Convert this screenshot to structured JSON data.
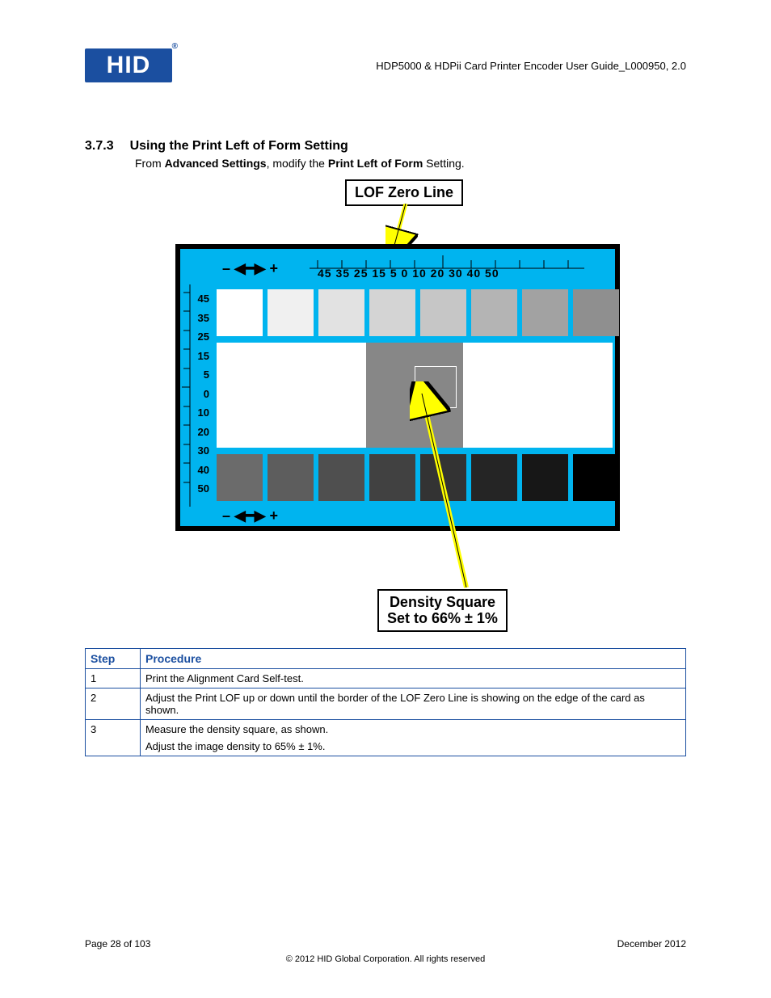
{
  "header": {
    "logo_text": "HID",
    "doc_title": "HDP5000 & HDPii Card Printer Encoder User Guide_L000950, 2.0"
  },
  "section": {
    "number": "3.7.3",
    "title": "Using the Print Left of Form Setting",
    "intro_pre": "From ",
    "intro_b1": "Advanced Settings",
    "intro_mid": ", modify the ",
    "intro_b2": "Print Left of Form",
    "intro_post": " Setting."
  },
  "diagram": {
    "lof_label": "LOF Zero Line",
    "density_label_l1": "Density Square",
    "density_label_l2": "Set to 66% ± 1%",
    "x_ticks": "45 35 25 15  5    0  10 20 30 40 50",
    "y_ticks": [
      "45",
      "35",
      "25",
      "15",
      "5",
      "0",
      "10",
      "20",
      "30",
      "40",
      "50"
    ],
    "top_squares": [
      "#ffffff",
      "#f0f0f0",
      "#e2e2e2",
      "#d4d4d4",
      "#c6c6c6",
      "#b4b4b4",
      "#a2a2a2",
      "#8f8f8f"
    ],
    "bot_squares": [
      "#6b6b6b",
      "#5d5d5d",
      "#4f4f4f",
      "#414141",
      "#333333",
      "#252525",
      "#171717",
      "#000000"
    ]
  },
  "table": {
    "col1": "Step",
    "col2": "Procedure",
    "rows": [
      {
        "step": "1",
        "proc": "Print the Alignment Card Self-test."
      },
      {
        "step": "2",
        "proc": "Adjust the Print LOF up or down until the border of the LOF Zero Line is showing on the edge of the card as shown."
      },
      {
        "step": "3",
        "proc_l1": "Measure the density square, as shown.",
        "proc_l2": "Adjust the image density to 65% ± 1%."
      }
    ]
  },
  "footer": {
    "page": "Page 28 of 103",
    "date": "December 2012",
    "copyright": "© 2012 HID Global Corporation. All rights reserved"
  }
}
